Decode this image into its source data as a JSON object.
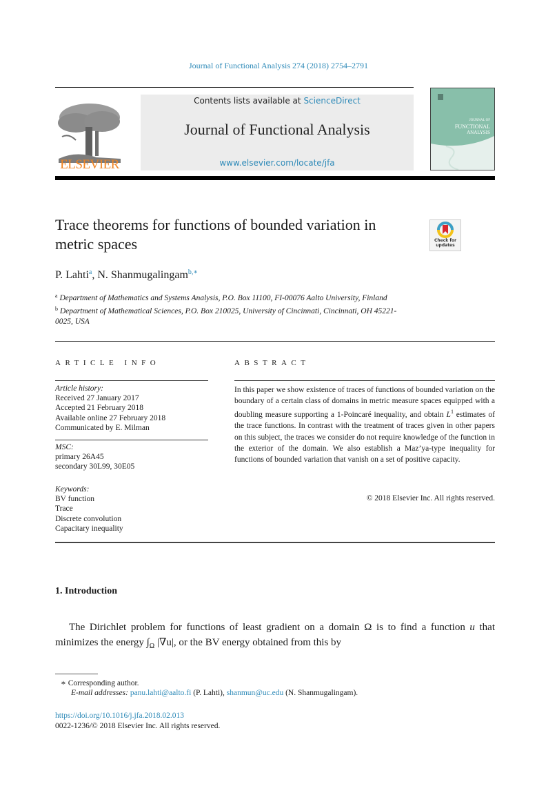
{
  "running_head": "Journal of Functional Analysis 274 (2018) 2754–2791",
  "masthead": {
    "publisher": "ELSEVIER",
    "contents_prefix": "Contents lists available at ",
    "contents_link": "ScienceDirect",
    "journal_name": "Journal of Functional Analysis",
    "journal_url": "www.elsevier.com/locate/jfa",
    "cover_title_line1": "JOURNAL OF",
    "cover_title_line2": "FUNCTIONAL",
    "cover_title_line3": "ANALYSIS"
  },
  "crossmark": {
    "line1": "Check for",
    "line2": "updates"
  },
  "title": "Trace theorems for functions of bounded variation in metric spaces",
  "authors": [
    {
      "name": "P. Lahti",
      "sup": "a"
    },
    {
      "name": "N. Shanmugalingam",
      "sup": "b,∗"
    }
  ],
  "affiliations": [
    {
      "sup": "a",
      "text": "Department of Mathematics and Systems Analysis, P.O. Box 11100, FI-00076 Aalto University, Finland"
    },
    {
      "sup": "b",
      "text": "Department of Mathematical Sciences, P.O. Box 210025, University of Cincinnati, Cincinnati, OH 45221-0025, USA"
    }
  ],
  "article_info": {
    "heading": "ARTICLE INFO",
    "history_label": "Article history:",
    "history": [
      "Received 27 January 2017",
      "Accepted 21 February 2018",
      "Available online 27 February 2018",
      "Communicated by E. Milman"
    ],
    "msc_label": "MSC:",
    "msc": [
      "primary 26A45",
      "secondary 30L99, 30E05"
    ],
    "keywords_label": "Keywords:",
    "keywords": [
      "BV function",
      "Trace",
      "Discrete convolution",
      "Capacitary inequality"
    ]
  },
  "abstract": {
    "heading": "ABSTRACT",
    "text_before_L": "In this paper we show existence of traces of functions of bounded variation on the boundary of a certain class of domains in metric measure spaces equipped with a doubling measure supporting a 1-Poincaré inequality, and obtain ",
    "L_symbol": "L",
    "L_sup": "1",
    "text_after_L": " estimates of the trace functions. In contrast with the treatment of traces given in other papers on this subject, the traces we consider do not require knowledge of the function in the exterior of the domain. We also establish a Maz’ya-type inequality for functions of bounded variation that vanish on a set of positive capacity.",
    "copyright": "© 2018 Elsevier Inc. All rights reserved."
  },
  "section": {
    "heading": "1. Introduction",
    "para_part1": "The Dirichlet problem for functions of least gradient on a domain Ω is to find a function ",
    "para_var": "u",
    "para_part2": " that minimizes the energy ",
    "para_integral": "∫",
    "para_sub": "Ω",
    "para_part3": " |∇u|, or the BV energy obtained from this by"
  },
  "footnotes": {
    "corresponding_mark": "∗",
    "corresponding": "Corresponding author.",
    "email_label": "E-mail addresses:",
    "email1": "panu.lahti@aalto.fi",
    "email1_owner": " (P. Lahti), ",
    "email2": "shanmun@uc.edu",
    "email2_owner": " (N. Shanmugalingam)."
  },
  "doi": "https://doi.org/10.1016/j.jfa.2018.02.013",
  "issn_line": "0022-1236/© 2018 Elsevier Inc. All rights reserved.",
  "colors": {
    "link": "#2e8ab8",
    "elsevier_orange": "#f08321",
    "masthead_bg": "#ececec",
    "cover_green": "#88bfaa"
  }
}
